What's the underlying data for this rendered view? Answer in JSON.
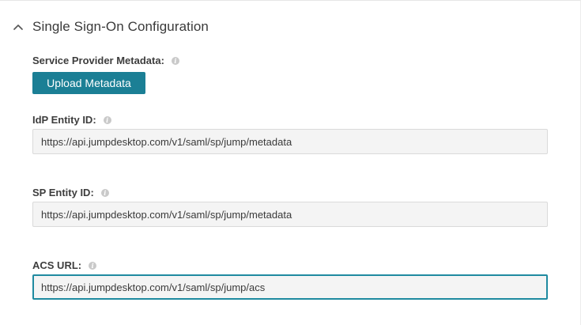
{
  "section": {
    "title": "Single Sign-On Configuration",
    "expanded": true,
    "toggle_icon": "chevron-up-icon"
  },
  "service_provider_metadata": {
    "label": "Service Provider Metadata:",
    "info_icon": "info-icon",
    "button_label": "Upload Metadata"
  },
  "idp_entity_id": {
    "label": "IdP Entity ID:",
    "info_icon": "info-icon",
    "value": "https://api.jumpdesktop.com/v1/saml/sp/jump/metadata"
  },
  "sp_entity_id": {
    "label": "SP Entity ID:",
    "info_icon": "info-icon",
    "value": "https://api.jumpdesktop.com/v1/saml/sp/jump/metadata"
  },
  "acs_url": {
    "label": "ACS URL:",
    "info_icon": "info-icon",
    "value": "https://api.jumpdesktop.com/v1/saml/sp/jump/acs",
    "focused": true
  },
  "colors": {
    "accent": "#1b7f95",
    "focus_border": "#1f8aa0",
    "input_background": "#f4f4f4",
    "label_text": "#3d3d3d"
  }
}
